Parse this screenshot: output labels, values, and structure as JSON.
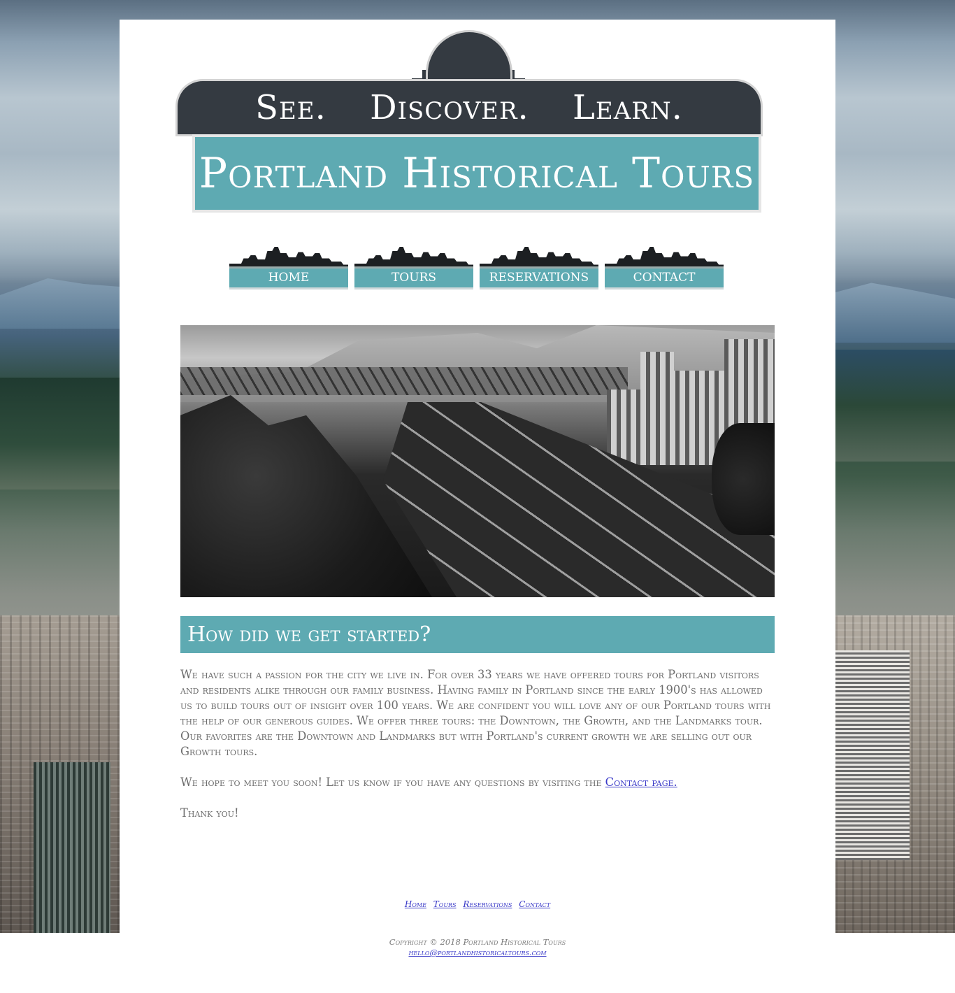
{
  "logo": {
    "tagline": [
      "See.",
      "Discover.",
      "Learn."
    ],
    "title": "Portland Historical Tours"
  },
  "nav": [
    {
      "label": "HOME"
    },
    {
      "label": "TOURS"
    },
    {
      "label": "RESERVATIONS"
    },
    {
      "label": "CONTACT"
    }
  ],
  "hero": {
    "icon": "historic-freeway-photo"
  },
  "section": {
    "heading": "How did we get started?",
    "paragraph1": "We have such a passion for the city we live in. For over 33 years we have offered tours for Portland visitors and residents alike through our family business. Having family in Portland since the early 1900's has allowed us to build tours out of insight over 100 years. We are confident you will love any of our Portland tours with the help of our generous guides. We offer three tours: the Downtown, the Growth, and the Landmarks tour. Our favorites are the Downtown and Landmarks but with Portland's current growth we are selling out our Growth tours.",
    "paragraph2_text": "We hope to meet you soon! Let us know if you have any questions by visiting the ",
    "paragraph2_link": "Contact page.",
    "paragraph3": "Thank you!"
  },
  "footer": {
    "links": [
      "Home",
      "Tours",
      "Reservations",
      "Contact"
    ],
    "copyright": "Copyright © 2018 Portland Historical Tours",
    "email": "hello@portlandhistoricaltours.com"
  },
  "colors": {
    "accent_teal": "#5eaab2",
    "dark_sign": "#343a41",
    "link": "#3a3ac8",
    "body_text": "#6d6d6d"
  }
}
